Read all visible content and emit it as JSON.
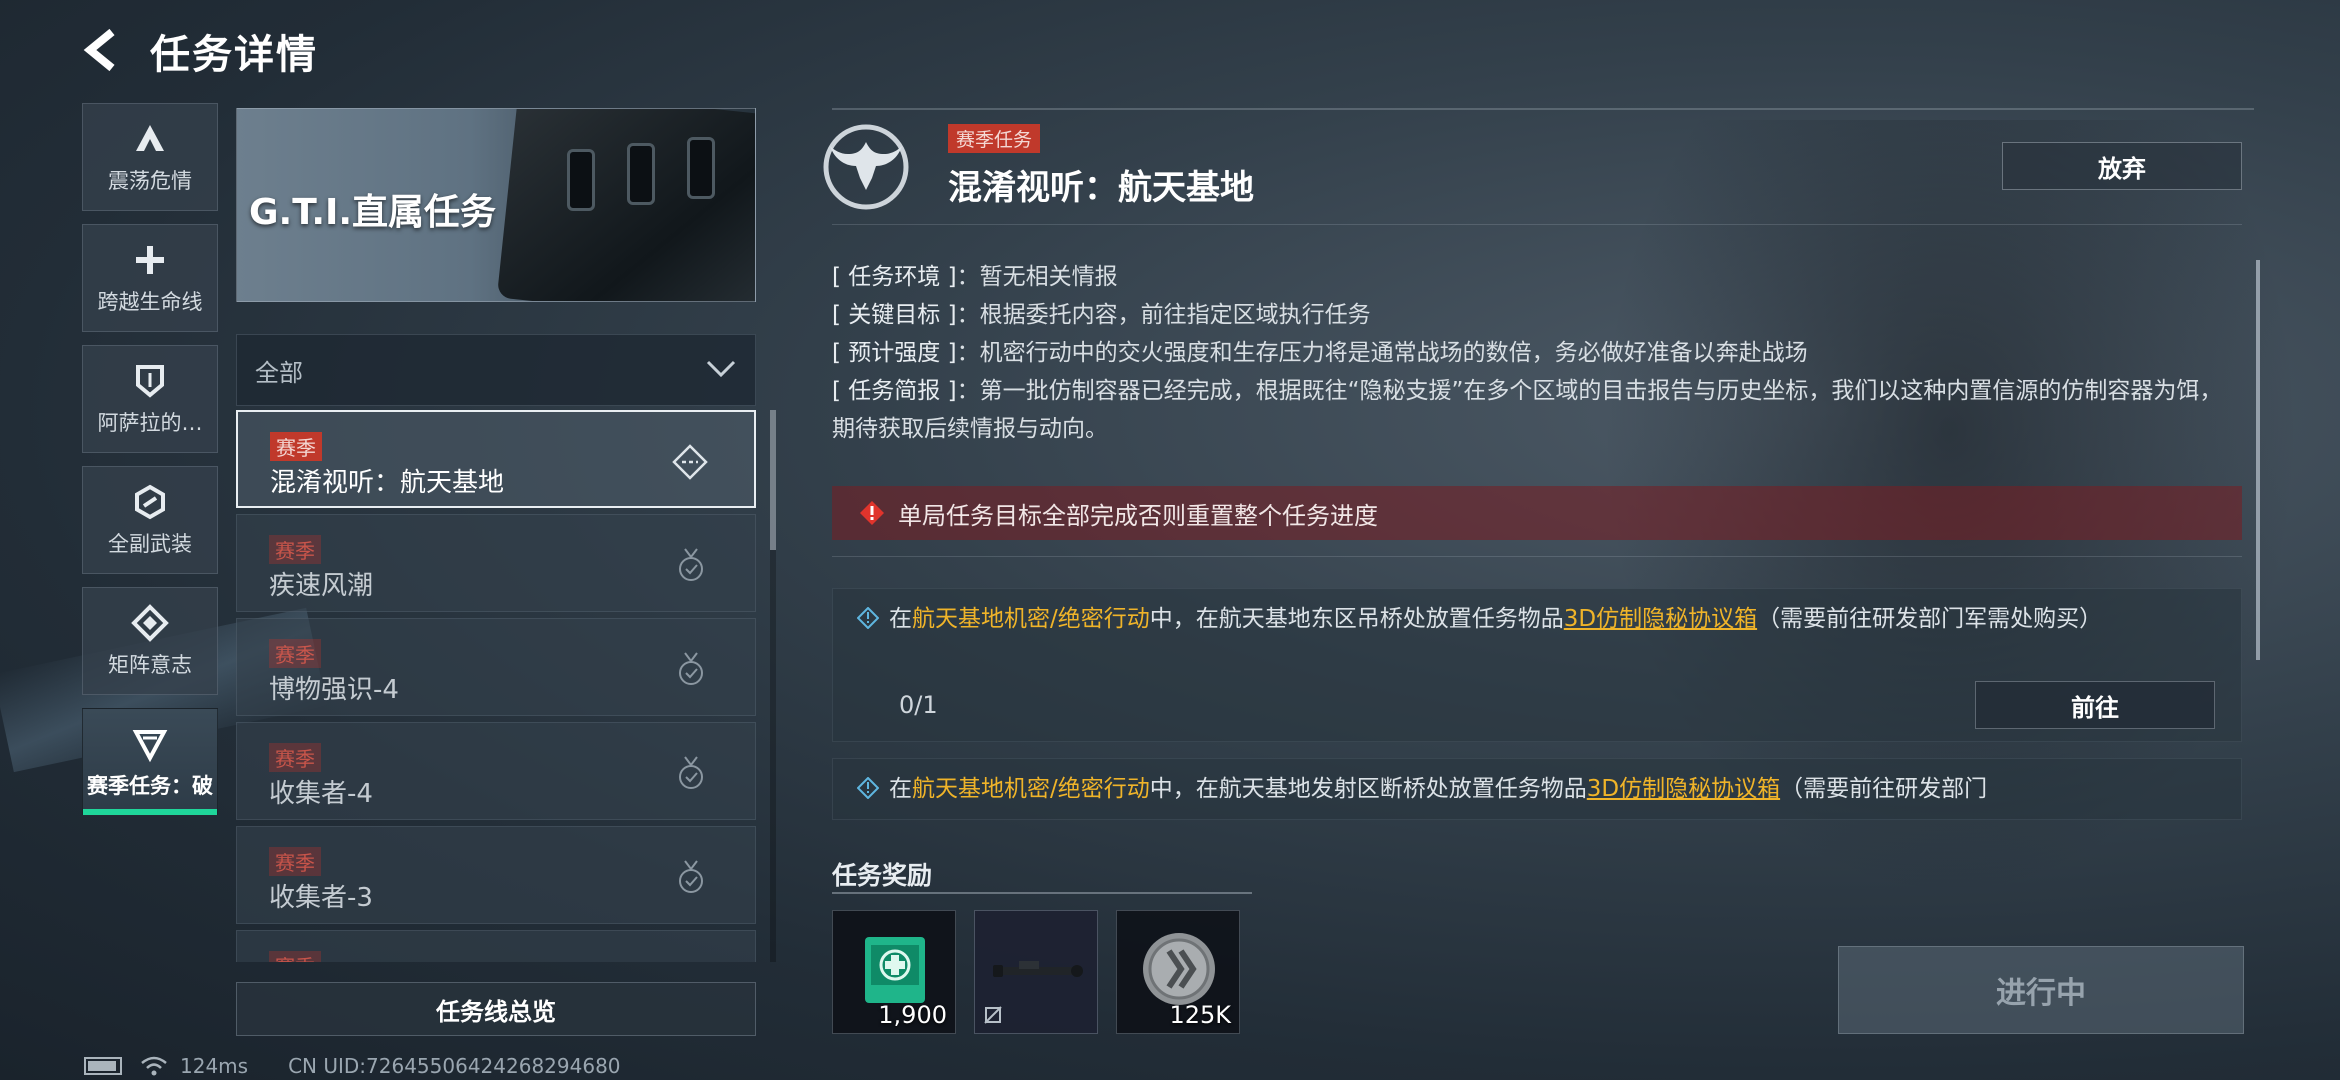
{
  "header": {
    "title": "任务详情"
  },
  "sidebar": {
    "tabs": [
      {
        "label": "震荡危情",
        "icon": "a-triangle-icon"
      },
      {
        "label": "跨越生命线",
        "icon": "plus-icon"
      },
      {
        "label": "阿萨拉的…",
        "icon": "shield-icon"
      },
      {
        "label": "全副武装",
        "icon": "hexagon-icon"
      },
      {
        "label": "矩阵意志",
        "icon": "diamond-icon"
      },
      {
        "label": "赛季任务：破",
        "icon": "triangle-icon",
        "active": true
      }
    ]
  },
  "banner": {
    "text": "G.T.I.直属任务"
  },
  "filter": {
    "selected": "全部"
  },
  "missions": [
    {
      "tag": "赛季",
      "name": "混淆视听：航天基地",
      "selected": true
    },
    {
      "tag": "赛季",
      "name": "疾速风潮"
    },
    {
      "tag": "赛季",
      "name": "博物强识-4"
    },
    {
      "tag": "赛季",
      "name": "收集者-4"
    },
    {
      "tag": "赛季",
      "name": "收集者-3"
    },
    {
      "tag": "赛季",
      "name": ""
    }
  ],
  "overview_button": "任务线总览",
  "detail": {
    "season_tag": "赛季任务",
    "title": "混淆视听：航天基地",
    "abandon_label": "放弃",
    "info": [
      {
        "key": "[ 任务环境 ]",
        "value": "：暂无相关情报"
      },
      {
        "key": "[ 关键目标 ]",
        "value": "：根据委托内容，前往指定区域执行任务"
      },
      {
        "key": "[ 预计强度 ]",
        "value": "：机密行动中的交火强度和生存压力将是通常战场的数倍，务必做好准备以奔赴战场"
      },
      {
        "key": "[ 任务简报 ]",
        "value": "：第一批仿制容器已经完成，根据既往“隐秘支援”在多个区域的目击报告与历史坐标，我们以这种内置信源的仿制容器为饵，期待获取后续情报与动向。"
      }
    ],
    "warning": "单局任务目标全部完成否则重置整个任务进度",
    "objectives": [
      {
        "pre": "在",
        "mode": "航天基地机密/绝密行动",
        "mid": "中，在航天基地东区吊桥处放置任务物品",
        "item": "3D仿制隐秘协议箱",
        "post": "（需要前往研发部门军需处购买）",
        "progress": "0/1",
        "goto_label": "前往"
      },
      {
        "pre": "在",
        "mode": "航天基地机密/绝密行动",
        "mid": "中，在航天基地发射区断桥处放置任务物品",
        "item": "3D仿制隐秘协议箱",
        "post": "（需要前往研发部门"
      }
    ],
    "reward_title": "任务奖励",
    "rewards": [
      {
        "icon": "medical-kit-icon",
        "qty": "1,900"
      },
      {
        "icon": "rifle-scope-icon",
        "qty": ""
      },
      {
        "icon": "coin-icon",
        "qty": "125K"
      }
    ],
    "status_button": "进行中"
  },
  "statusbar": {
    "ping": "124ms",
    "uid": "CN UID:72645506424268294680"
  },
  "colors": {
    "accent": "#1fd69a",
    "season": "#c0392b",
    "highlight": "#f0b429",
    "warning_bg": "#7a1e23"
  }
}
